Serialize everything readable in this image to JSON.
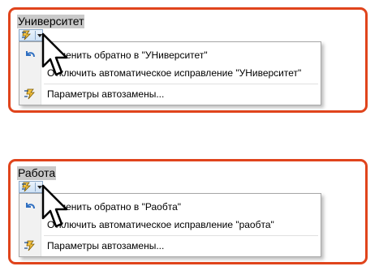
{
  "panels": [
    {
      "word": "Университет",
      "menu": {
        "items": [
          {
            "icon": "undo-icon",
            "label": "Отменить обратно в \"УНиверситет\""
          },
          {
            "icon": "none",
            "label": "Отключить автоматическое исправление \"УНиверситет\""
          },
          {
            "icon": "autocorrect-options-icon",
            "label": "Параметры автозамены..."
          }
        ]
      }
    },
    {
      "word": "Работа",
      "menu": {
        "items": [
          {
            "icon": "undo-icon",
            "label": "Отменить обратно в \"Раобта\""
          },
          {
            "icon": "none",
            "label": "Отключить автоматическое исправление \"раобта\""
          },
          {
            "icon": "autocorrect-options-icon",
            "label": "Параметры автозамены..."
          }
        ]
      }
    }
  ],
  "colors": {
    "frame": "#e0441c",
    "word_highlight": "#c9c9c9",
    "menu_border": "#a7a7a7",
    "button_border": "#8aa7c7"
  }
}
